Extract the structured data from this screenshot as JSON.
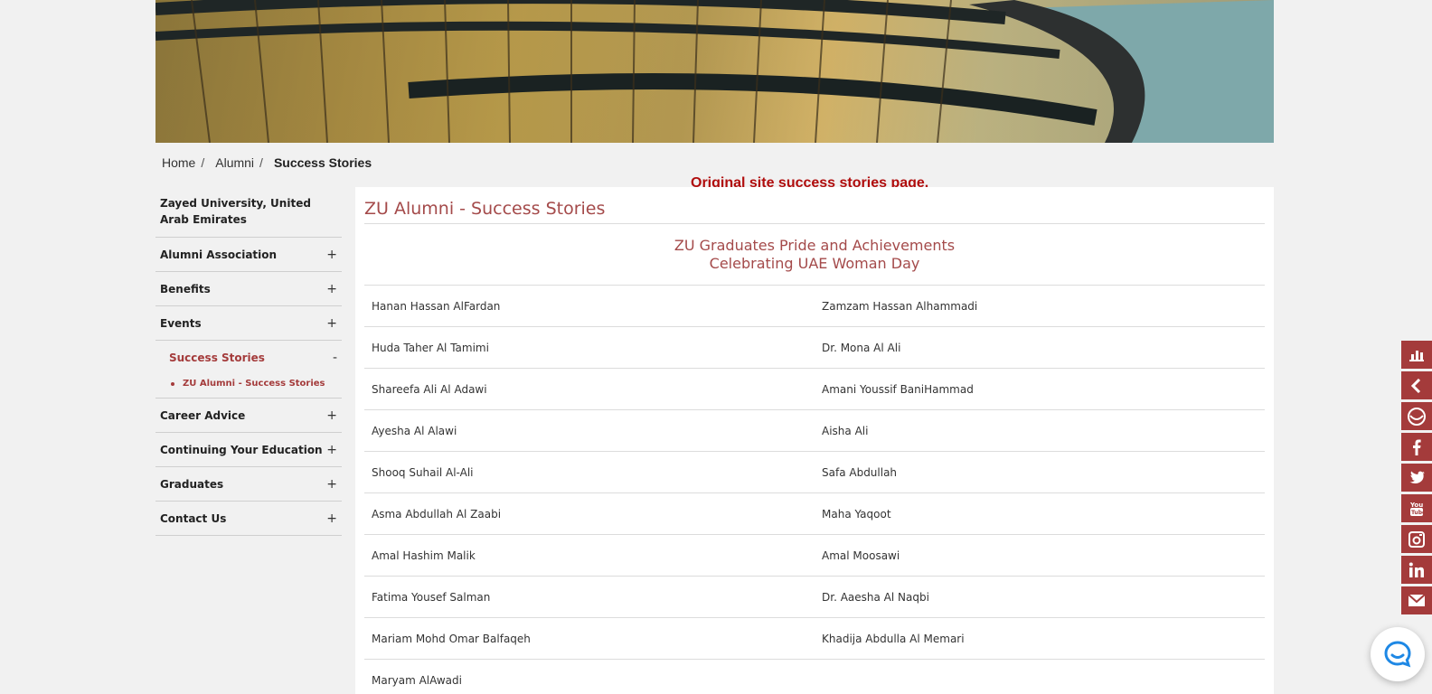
{
  "breadcrumb": {
    "home": "Home",
    "alumni": "Alumni",
    "current": "Success Stories",
    "sep": "/"
  },
  "annotation": "Original site success stories page.",
  "sidebar": {
    "title": "Zayed University, United Arab Emirates",
    "items": [
      {
        "label": "Alumni Association",
        "toggle": "+"
      },
      {
        "label": "Benefits",
        "toggle": "+"
      },
      {
        "label": "Events",
        "toggle": "+"
      },
      {
        "label": "Success Stories",
        "toggle": "-"
      },
      {
        "label": "Career Advice",
        "toggle": "+"
      },
      {
        "label": "Continuing Your Education",
        "toggle": "+"
      },
      {
        "label": "Graduates",
        "toggle": "+"
      },
      {
        "label": "Contact Us",
        "toggle": "+"
      }
    ],
    "sub_item": "ZU Alumni - Success Stories"
  },
  "main": {
    "title": "ZU Alumni - Success Stories",
    "heading_line1": "ZU Graduates Pride and Achievements",
    "heading_line2": "Celebrating UAE Woman Day",
    "rows": [
      [
        "Hanan Hassan AlFardan",
        "Zamzam Hassan Alhammadi"
      ],
      [
        "Huda Taher Al Tamimi",
        "Dr. Mona Al Ali"
      ],
      [
        "Shareefa Ali Al Adawi",
        "Amani Youssif BaniHammad"
      ],
      [
        "Ayesha Al Alawi",
        "Aisha Ali"
      ],
      [
        "Shooq Suhail Al-Ali",
        "Safa Abdullah"
      ],
      [
        "Asma Abdullah Al Zaabi",
        "Maha Yaqoot"
      ],
      [
        "Amal Hashim Malik",
        "Amal Moosawi"
      ],
      [
        "Fatima Yousef Salman",
        "Dr. Aaesha Al Naqbi"
      ],
      [
        "Mariam Mohd Omar Balfaqeh",
        "Khadija Abdulla Al Memari"
      ],
      [
        "Maryam AlAwadi",
        ""
      ]
    ]
  },
  "social": [
    "chart-icon",
    "chevron-left-icon",
    "circle-icon",
    "facebook-icon",
    "twitter-icon",
    "youtube-icon",
    "instagram-icon",
    "linkedin-icon",
    "mail-icon"
  ],
  "colors": {
    "accent": "#a43b3b",
    "title": "#a44a4a",
    "annotation": "#b00c0c"
  }
}
